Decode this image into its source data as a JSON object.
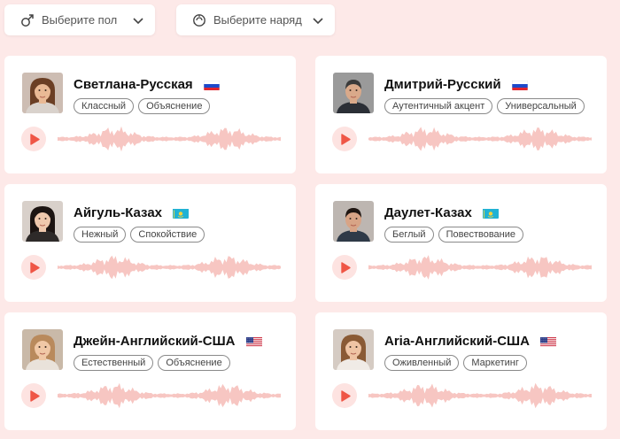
{
  "filters": {
    "gender": {
      "label": "Выберите пол"
    },
    "outfit": {
      "label": "Выберите наряд"
    }
  },
  "colors": {
    "accent": "#ef5646",
    "wave": "#f7c6c2",
    "background": "#fde9e8"
  },
  "voices": [
    {
      "name": "Светлана-Русская",
      "flag": "ru",
      "tags": [
        "Классный",
        "Объяснение"
      ]
    },
    {
      "name": "Дмитрий-Русский",
      "flag": "ru",
      "tags": [
        "Аутентичный акцент",
        "Универсальный"
      ]
    },
    {
      "name": "Айгуль-Казах",
      "flag": "kz",
      "tags": [
        "Нежный",
        "Спокойствие"
      ]
    },
    {
      "name": "Даулет-Казах",
      "flag": "kz",
      "tags": [
        "Беглый",
        "Повествование"
      ]
    },
    {
      "name": "Джейн-Английский-США",
      "flag": "us",
      "tags": [
        "Естественный",
        "Объяснение"
      ]
    },
    {
      "name": "Aria-Английский-США",
      "flag": "us",
      "tags": [
        "Оживленный",
        "Маркетинг"
      ]
    }
  ]
}
